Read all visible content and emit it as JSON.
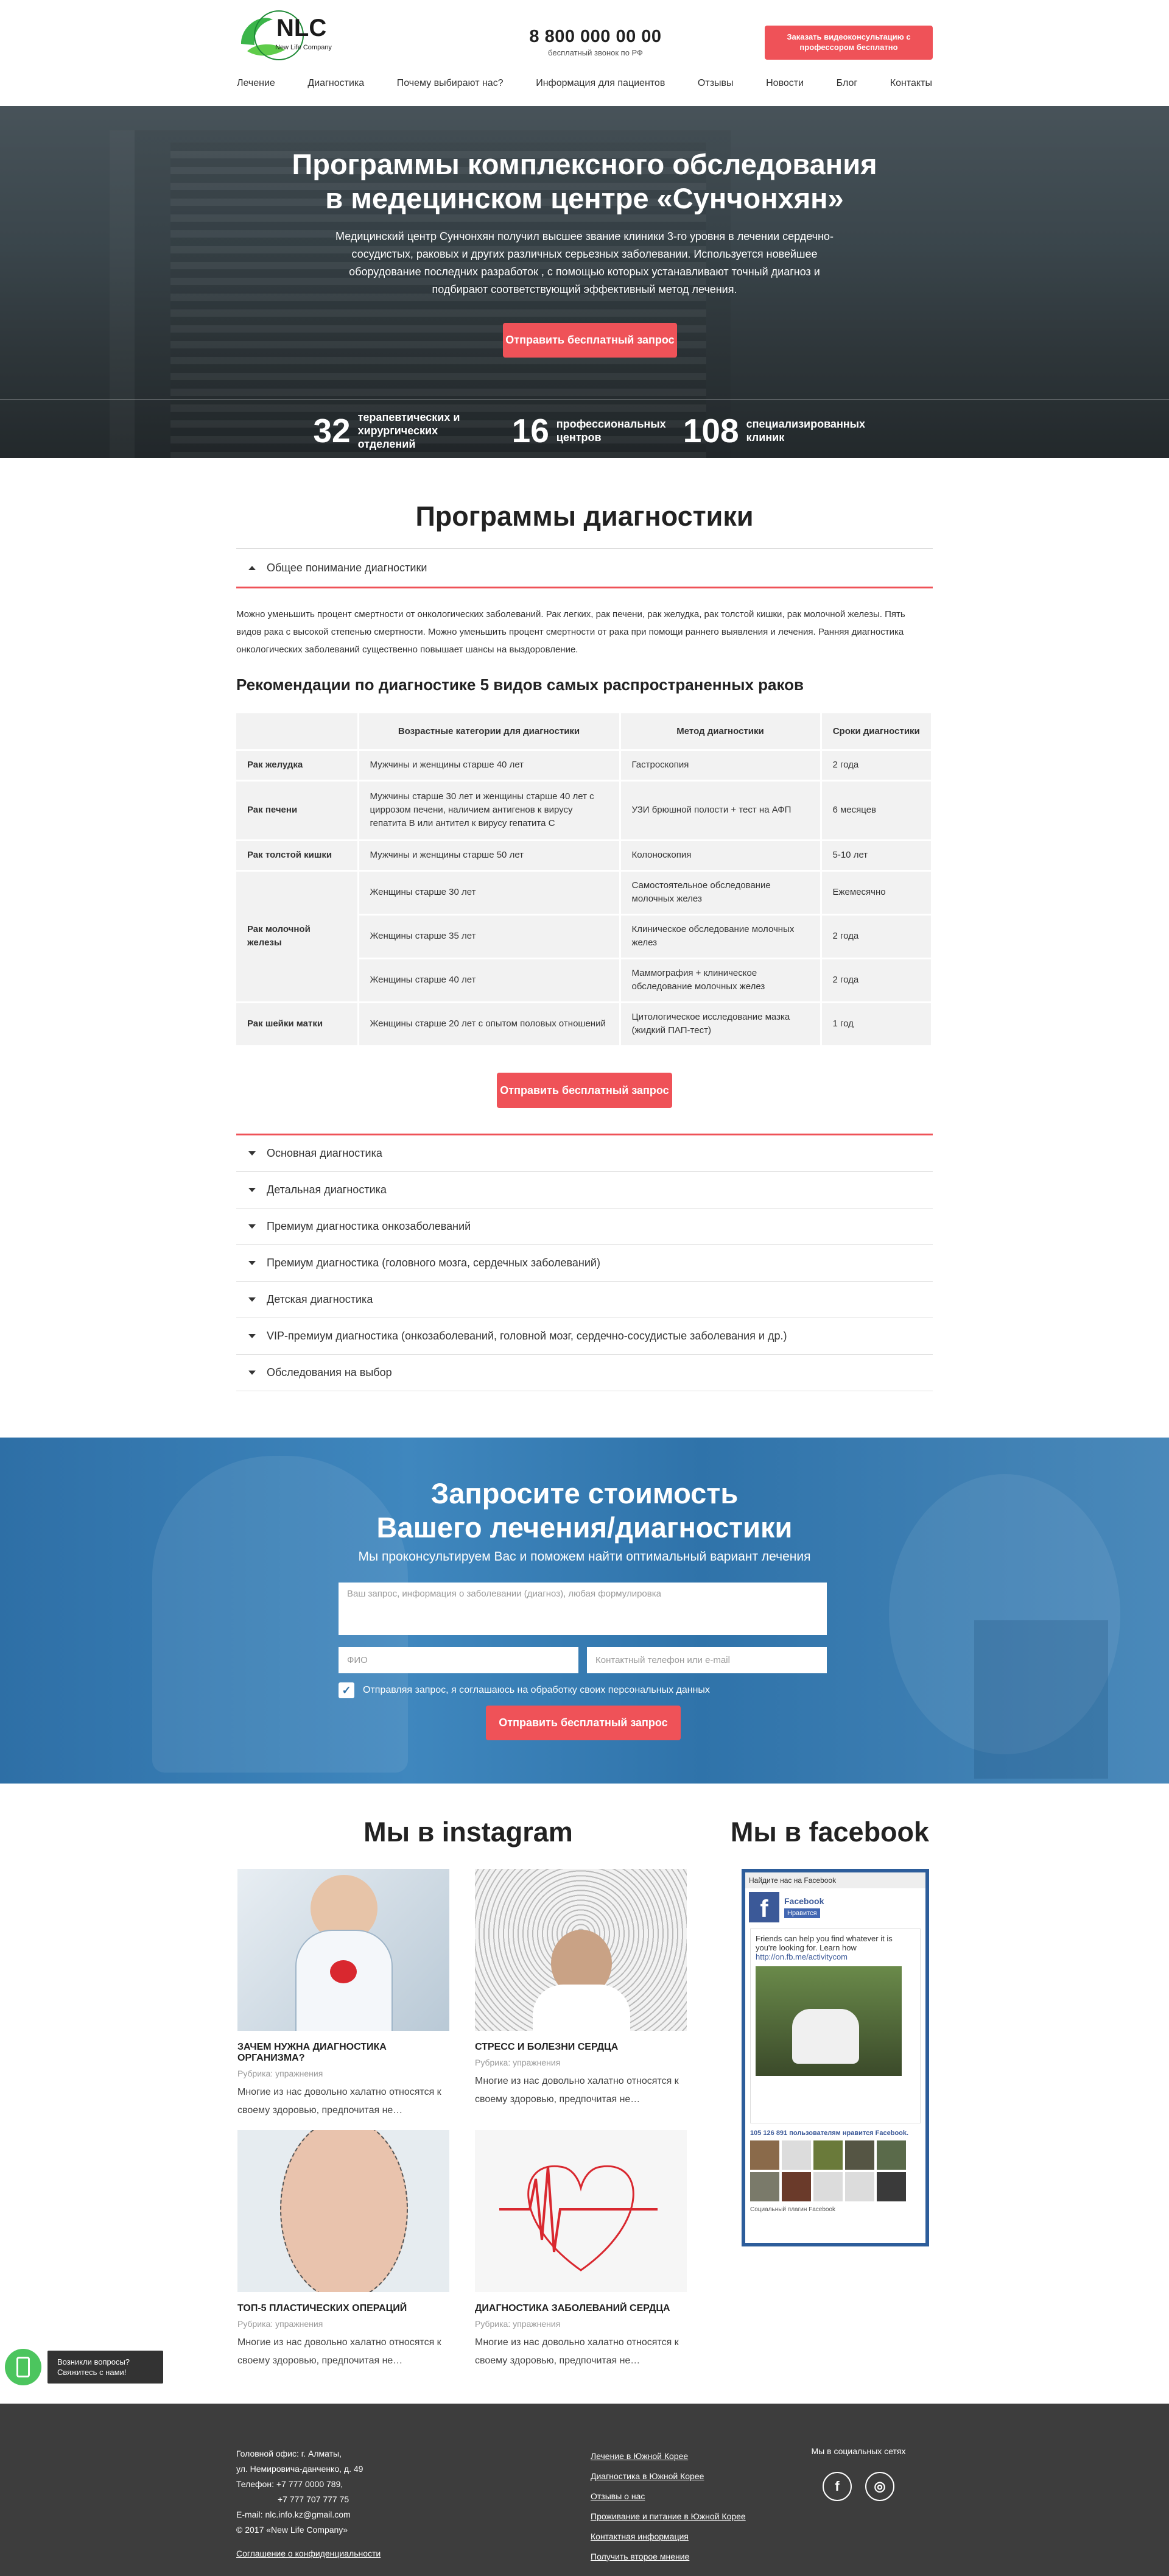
{
  "header": {
    "logo_text": "NLC",
    "logo_sub": "New Life Company",
    "phone": "8 800 000 00 00",
    "phone_sub": "бесплатный звонок по РФ",
    "cta": "Заказать видеоконсультацию с профессором бесплатно"
  },
  "nav": [
    "Лечение",
    "Диагностика",
    "Почему выбирают нас?",
    "Информация для пациентов",
    "Отзывы",
    "Новости",
    "Блог",
    "Контакты"
  ],
  "hero": {
    "title_1": "Программы комплексного обследования",
    "title_2": "в медецинском центре «Сунчонхян»",
    "text": "Медицинский центр Сунчонхян получил высшее звание клиники 3-го уровня в лечении сердечно-сосудистых, раковых и других различных серьезных заболевании. Используется новейшее оборудование последних разработок , с помощью которых устанавливают точный диагноз и подбирают соответствующий эффективный метод лечения.",
    "cta": "Отправить бесплатный запрос",
    "stats": [
      {
        "n": "32",
        "t": "терапевтических и хирургических отделений"
      },
      {
        "n": "16",
        "t": "профессиональных центров"
      },
      {
        "n": "108",
        "t": "специализированных клиник"
      }
    ]
  },
  "programs": {
    "title": "Программы диагностики",
    "open_item": "Общее понимание диагностики",
    "body": "Можно уменьшить процент смертности от онкологических заболеваний. Рак легких, рак печени, рак желудка, рак толстой кишки, рак молочной железы. Пять видов рака с высокой степенью смертности. Можно уменьшить процент смертности от рака при помощи раннего выявления и лечения. Ранняя диагностика онкологических заболеваний существенно повышает шансы на выздоровление.",
    "rec_title": "Рекомендации по диагностике 5 видов самых распространенных раков",
    "table": {
      "headers": [
        "",
        "Возрастные категории для диагностики",
        "Метод диагностики",
        "Сроки диагностики"
      ],
      "rows": [
        {
          "name": "Рак желудка",
          "age": "Мужчины и женщины старше 40 лет",
          "method": "Гастроскопия",
          "term": "2 года"
        },
        {
          "name": "Рак печени",
          "age": "Мужчины старше 30 лет и женщины старше 40 лет с циррозом печени, наличием антигенов к вирусу гепатита В или антител к вирусу гепатита С",
          "method": "УЗИ брюшной полости + тест на АФП",
          "term": "6 месяцев"
        },
        {
          "name": "Рак толстой кишки",
          "age": "Мужчины и женщины старше 50 лет",
          "method": "Колоноскопия",
          "term": "5-10 лет"
        },
        {
          "name": "Рак молочной железы",
          "age": "Женщины старше 30 лет",
          "method": "Самостоятельное обследование молочных желез",
          "term": "Ежемесячно"
        },
        {
          "name": "",
          "age": "Женщины старше 35 лет",
          "method": "Клиническое обследование молочных желез",
          "term": "2 года"
        },
        {
          "name": "",
          "age": "Женщины старше 40 лет",
          "method": "Маммография + клиническое обследование молочных желез",
          "term": "2 года"
        },
        {
          "name": "Рак шейки матки",
          "age": "Женщины старше 20 лет с опытом половых отношений",
          "method": "Цитологическое исследование мазка (жидкий ПАП-тест)",
          "term": "1 год"
        }
      ]
    },
    "cta": "Отправить бесплатный запрос",
    "items": [
      "Основная диагностика",
      "Детальная диагностика",
      "Премиум диагностика онкозаболеваний",
      "Премиум диагностика (головного мозга, сердечных заболеваний)",
      "Детская диагностика",
      "VIP-премиум диагностика (онкозаболеваний, головной мозг, сердечно-сосудистые заболевания и др.)",
      "Обследования на выбор"
    ]
  },
  "request": {
    "title_1": "Запросите стоимость",
    "title_2": "Вашего лечения/диагностики",
    "sub": "Мы проконсультируем Вас и поможем найти оптимальный вариант лечения",
    "textarea_ph": "Ваш запрос, информация о заболевании (диагноз), любая формулировка",
    "name_ph": "ФИО",
    "contact_ph": "Контактный телефон или e-mail",
    "agree": "Отправляя запрос, я соглашаюсь на обработку своих персональных данных",
    "cta": "Отправить бесплатный запрос"
  },
  "instagram": {
    "title": "Мы в instagram",
    "posts": [
      {
        "title": "Зачем нужна диагностика организма?",
        "cat": "Рубрика: упражнения",
        "text": "Многие из нас довольно халатно относятся к своему здоровью, предпочитая не…"
      },
      {
        "title": "Стресс и болезни сердца",
        "cat": "Рубрика: упражнения",
        "text": "Многие из нас довольно халатно относятся к своему здоровью, предпочитая не…"
      },
      {
        "title": "Топ-5 пластических операций",
        "cat": "Рубрика: упражнения",
        "text": "Многие из нас довольно халатно относятся к своему здоровью, предпочитая не…"
      },
      {
        "title": "Диагностика заболеваний сердца",
        "cat": "Рубрика: упражнения",
        "text": "Многие из нас довольно халатно относятся к своему здоровью, предпочитая не…"
      }
    ]
  },
  "facebook": {
    "title": "Мы в facebook",
    "widget_head": "Найдите нас на Facebook",
    "page_name": "Facebook",
    "like": "Нравится",
    "feed_text": "Friends can help you find whatever it is you're looking for. Learn how",
    "feed_link": "http://on.fb.me/activitycom",
    "likes": "105 126 891 пользователям нравится",
    "likes_brand": "Facebook.",
    "plugin": "Социальный плагин Facebook"
  },
  "chat": {
    "text": "Возникли вопросы? Свяжитесь с нами!"
  },
  "footer": {
    "address_1": "Головной офис: г. Алматы,",
    "address_2": "ул. Немировича-данченко, д. 49",
    "phone_1": "Телефон: +7 777 0000 789,",
    "phone_2": "+7 777 707 777 75",
    "email": "E-mail: nlc.info.kz@gmail.com",
    "copy": "© 2017 «New Life Company»",
    "policy": "Соглашение о конфиденциальности",
    "links": [
      "Лечение в Южной Корее",
      "Диагностика в Южной Корее",
      "Отзывы о нас",
      "Проживание и питание в Южной Корее",
      "Контактная информация",
      "Получить второе мнение"
    ],
    "social_title": "Мы в социальных сетях",
    "accent": "#ef5258",
    "blue": "#2e6fa6"
  }
}
